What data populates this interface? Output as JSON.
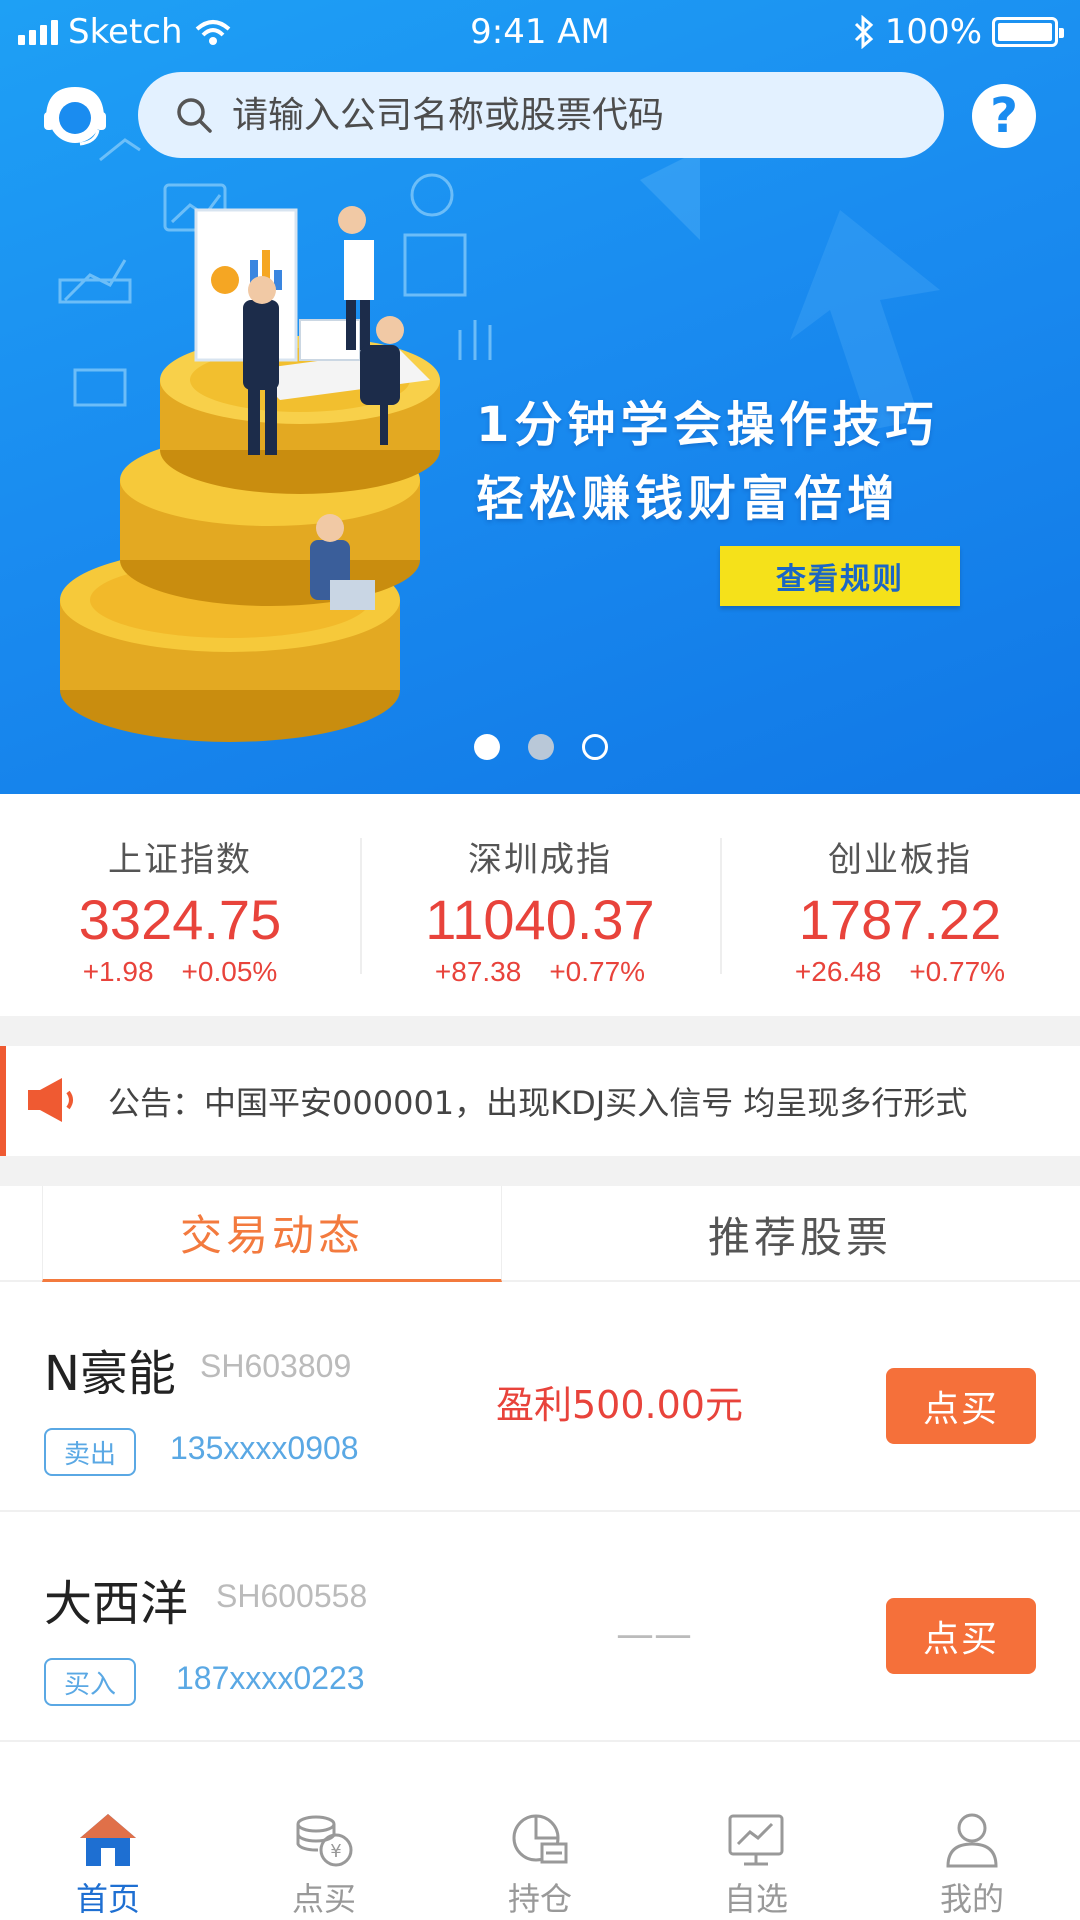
{
  "status_bar": {
    "carrier": "Sketch",
    "time": "9:41 AM",
    "battery": "100%"
  },
  "search": {
    "placeholder": "请输入公司名称或股票代码"
  },
  "help": {
    "label": "?"
  },
  "banner": {
    "slogan_line1": "1分钟学会操作技巧",
    "slogan_line2": "轻松赚钱财富倍增",
    "button_label": "查看规则",
    "page_count": 3,
    "active_page": 1
  },
  "indices": [
    {
      "name": "上证指数",
      "value": "3324.75",
      "change": "+1.98",
      "change_pct": "+0.05%"
    },
    {
      "name": "深圳成指",
      "value": "11040.37",
      "change": "+87.38",
      "change_pct": "+0.77%"
    },
    {
      "name": "创业板指",
      "value": "1787.22",
      "change": "+26.48",
      "change_pct": "+0.77%"
    }
  ],
  "notice": {
    "text": "公告：中国平安000001，出现KDJ买入信号 均呈现多行形式"
  },
  "tabs": [
    {
      "label": "交易动态",
      "active": true
    },
    {
      "label": "推荐股票",
      "active": false
    }
  ],
  "trades": [
    {
      "name": "N豪能",
      "code": "SH603809",
      "action": "卖出",
      "phone": "135xxxx0908",
      "result": "盈利500.00元",
      "buy_label": "点买"
    },
    {
      "name": "大西洋",
      "code": "SH600558",
      "action": "买入",
      "phone": "187xxxx0223",
      "result": "——",
      "buy_label": "点买"
    }
  ],
  "bottom_nav": [
    {
      "label": "首页",
      "icon": "home-icon",
      "active": true
    },
    {
      "label": "点买",
      "icon": "coins-icon",
      "active": false
    },
    {
      "label": "持仓",
      "icon": "pie-chart-icon",
      "active": false
    },
    {
      "label": "自选",
      "icon": "monitor-chart-icon",
      "active": false
    },
    {
      "label": "我的",
      "icon": "user-icon",
      "active": false
    }
  ],
  "colors": {
    "brand_blue": "#1a8cf0",
    "rise_red": "#e8433b",
    "accent_orange": "#f5703a",
    "button_yellow": "#f5e11a"
  }
}
